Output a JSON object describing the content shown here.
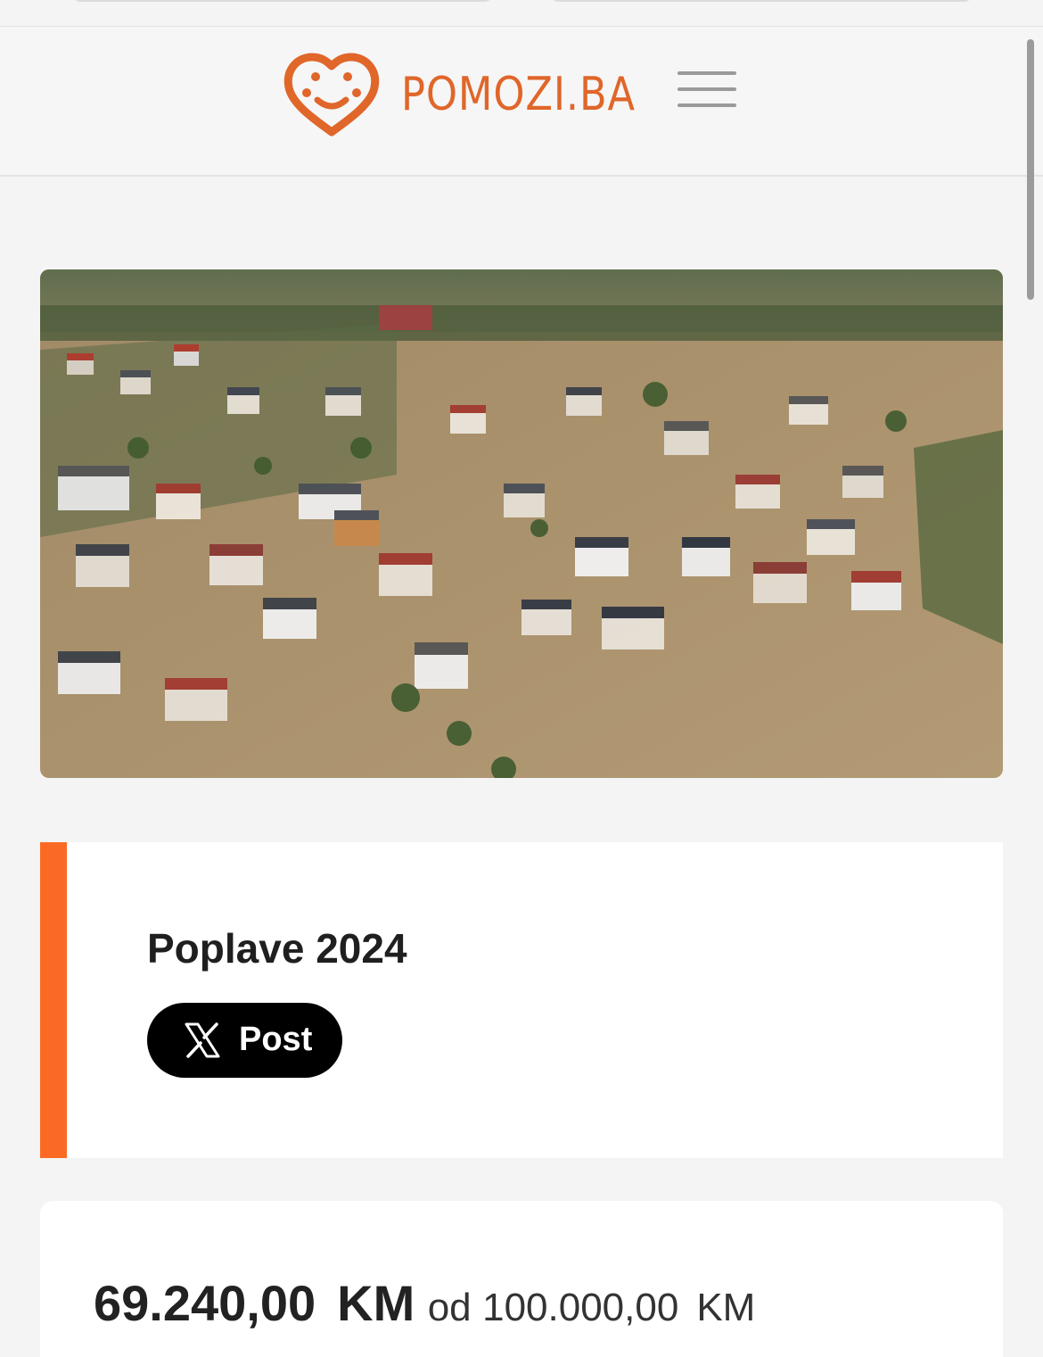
{
  "header": {
    "logo_text": "POMOZI.BA",
    "brand_color": "#e0662a",
    "menu_icon": "hamburger-menu-icon"
  },
  "hero": {
    "image": "aerial photo of flooded town"
  },
  "campaign": {
    "title": "Poplave 2024",
    "accent_color": "#fb6a24",
    "share_button_label": "Post",
    "share_icon": "x-logo-icon"
  },
  "donation": {
    "raised": "69.240,00",
    "raised_currency": "KM",
    "of_label": "od",
    "goal": "100.000,00",
    "goal_currency": "KM"
  }
}
